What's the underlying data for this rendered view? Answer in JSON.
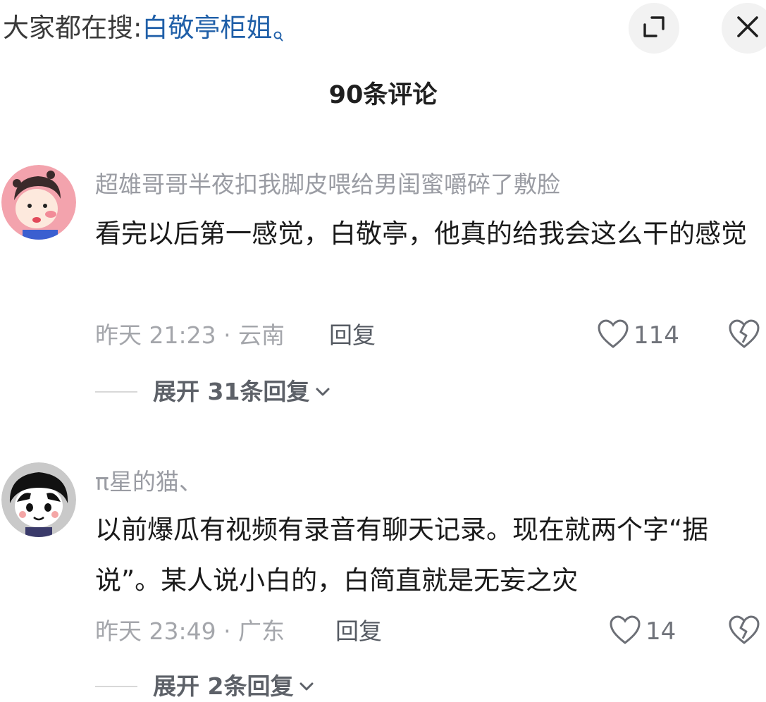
{
  "search_hint": {
    "prefix": "大家都在搜:",
    "term": "白敬亭柜姐"
  },
  "header": {
    "title": "90条评论"
  },
  "comments": [
    {
      "username": "超雄哥哥半夜扣我脚皮喂给男闺蜜嚼碎了敷脸",
      "text": "看完以后第一感觉，白敬亭，他真的给我会这么干的感觉",
      "meta": "昨天 21:23 · 云南",
      "reply_label": "回复",
      "likes": "114",
      "expand_label": "展开 31条回复"
    },
    {
      "username": "π星的猫、",
      "text": "以前爆瓜有视频有录音有聊天记录。现在就两个字“据说”。某人说小白的，白简直就是无妄之灾",
      "meta": "昨天 23:49 · 广东",
      "reply_label": "回复",
      "likes": "14",
      "expand_label": "展开 2条回复"
    }
  ],
  "colors": {
    "search_term": "#1f5fa8",
    "muted_text": "#9a9ca3",
    "body_text": "#1a1a1a"
  },
  "icons": {
    "search_mini": "magnifier-icon",
    "expand": "expand-corner-icon",
    "close": "close-x-icon",
    "like": "heart-outline-icon",
    "dislike": "broken-heart-icon",
    "chevron": "chevron-down-icon"
  }
}
